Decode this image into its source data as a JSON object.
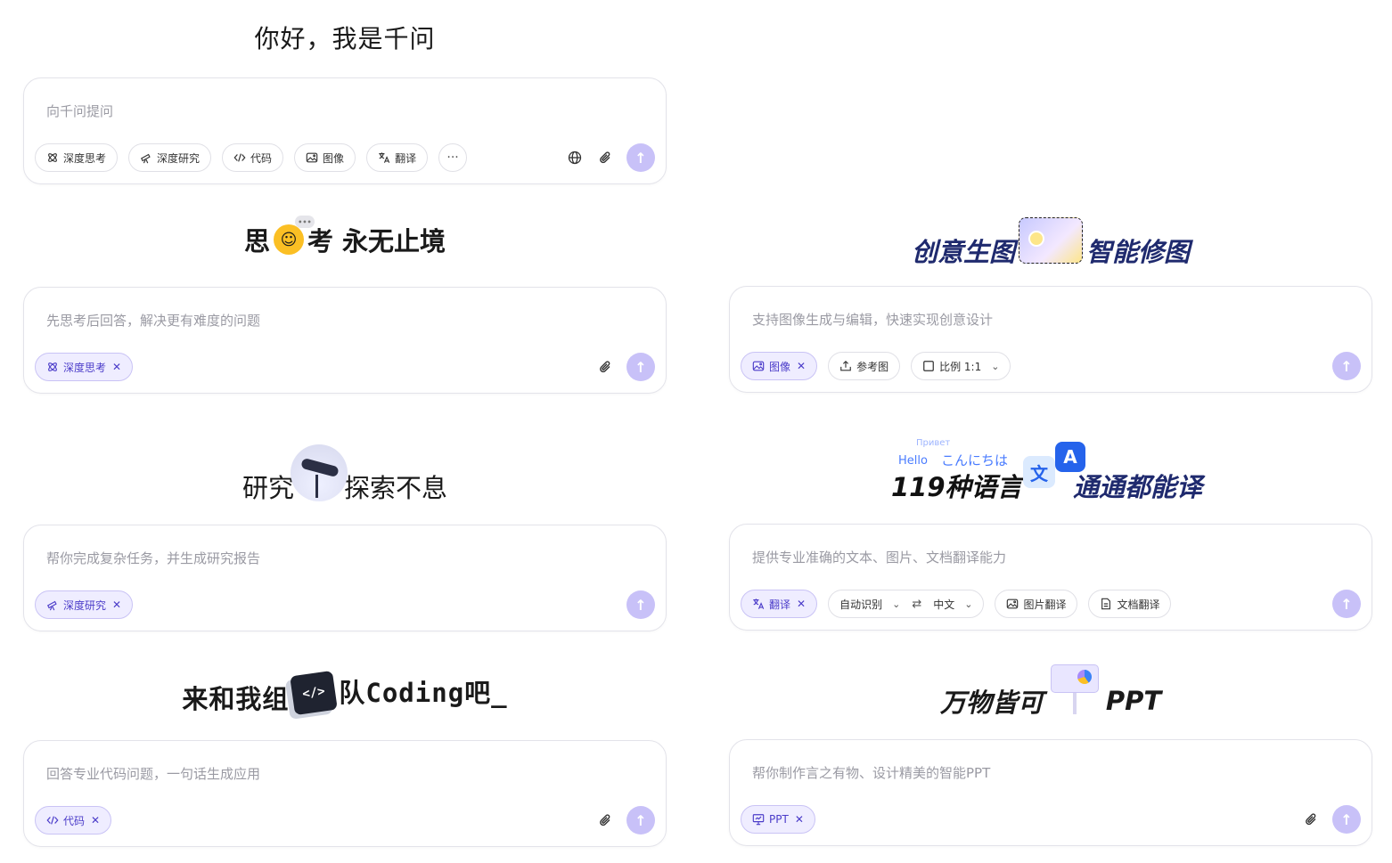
{
  "main": {
    "greeting": "你好，我是千问",
    "placeholder": "向千问提问",
    "chips": [
      "深度思考",
      "深度研究",
      "代码",
      "图像",
      "翻译"
    ],
    "more": "···"
  },
  "cards": {
    "think": {
      "title_a": "思",
      "title_b": "考 永无止境",
      "placeholder": "先思考后回答，解决更有难度的问题",
      "chip": "深度思考"
    },
    "image": {
      "title_a": "创意生图",
      "title_b": "智能修图",
      "placeholder": "支持图像生成与编辑，快速实现创意设计",
      "chip": "图像",
      "ref": "参考图",
      "ratio": "比例 1:1"
    },
    "research": {
      "title_a": "研究",
      "title_b": "探索不息",
      "placeholder": "帮你完成复杂任务，并生成研究报告",
      "chip": "深度研究"
    },
    "translate": {
      "hello": "Hello",
      "konnichiwa": "こんにちは",
      "privet": "Привет",
      "title_a": "119种语言",
      "title_b": "通通都能译",
      "placeholder": "提供专业准确的文本、图片、文档翻译能力",
      "chip": "翻译",
      "source_lang": "自动识别",
      "target_lang": "中文",
      "image_translate": "图片翻译",
      "doc_translate": "文档翻译"
    },
    "code": {
      "title_a": "来和我组",
      "title_b": "队Coding吧_",
      "placeholder": "回答专业代码问题，一句话生成应用",
      "chip": "代码"
    },
    "ppt": {
      "title_a": "万物皆可",
      "title_b": "PPT",
      "placeholder": "帮你制作言之有物、设计精美的智能PPT",
      "chip": "PPT"
    }
  },
  "icons": {
    "think": "atom-icon",
    "research": "telescope-icon",
    "code": "code-icon",
    "image": "image-icon",
    "translate": "translate-icon",
    "globe": "globe-icon",
    "attach": "paperclip-icon",
    "send": "arrow-up-icon",
    "upload": "upload-icon",
    "ratio": "square-icon",
    "doc": "document-icon",
    "ppt": "presentation-icon"
  },
  "colors": {
    "accent": "#4b3cc9",
    "chip_active_bg": "#efedff",
    "send_bg": "#c8c1f8",
    "border": "#e3e3ea",
    "placeholder": "#9a9aa3"
  }
}
